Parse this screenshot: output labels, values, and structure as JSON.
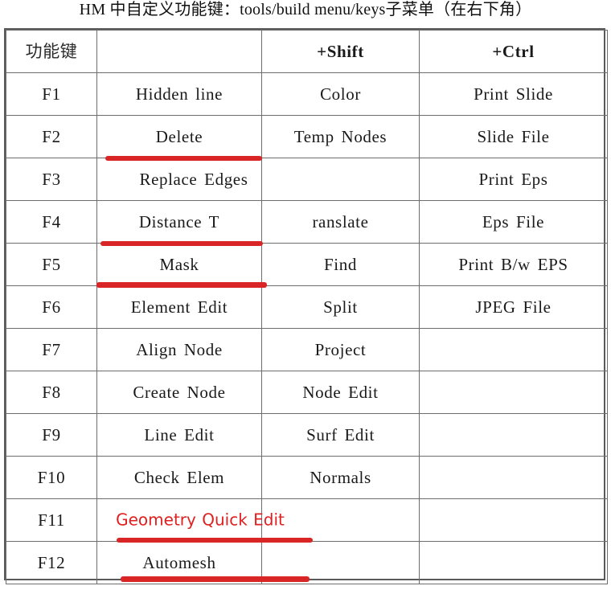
{
  "title": "HM 中自定义功能键：tools/build  menu/keys子菜单（在右下角）",
  "table": {
    "headers": {
      "key": "功能键",
      "plain": "",
      "shift": "+Shift",
      "ctrl": "+Ctrl"
    },
    "rows": [
      {
        "key": "F1",
        "plain": "Hidden  line",
        "shift": "Color",
        "ctrl": "Print  Slide"
      },
      {
        "key": "F2",
        "plain": "Delete",
        "shift": "Temp  Nodes",
        "ctrl": "Slide  File"
      },
      {
        "key": "F3",
        "plain": "Replace  Edges",
        "shift": "",
        "ctrl": "Print Eps"
      },
      {
        "key": "F4",
        "plain": "Distance  T",
        "shift": "ranslate",
        "ctrl": "Eps File"
      },
      {
        "key": "F5",
        "plain": "Mask",
        "shift": "Find",
        "ctrl": "Print  B/w  EPS"
      },
      {
        "key": "F6",
        "plain": "Element  Edit",
        "shift": "Split",
        "ctrl": "JPEG  File"
      },
      {
        "key": "F7",
        "plain": "Align  Node",
        "shift": "Project",
        "ctrl": ""
      },
      {
        "key": "F8",
        "plain": "Create  Node",
        "shift": "Node  Edit",
        "ctrl": ""
      },
      {
        "key": "F9",
        "plain": "Line  Edit",
        "shift": "Surf  Edit",
        "ctrl": ""
      },
      {
        "key": "F10",
        "plain": "Check  Elem",
        "shift": "Normals",
        "ctrl": ""
      },
      {
        "key": "F11",
        "plain": "Geometry Quick Edit",
        "shift": "",
        "ctrl": ""
      },
      {
        "key": "F12",
        "plain": "Automesh",
        "shift": "",
        "ctrl": ""
      }
    ]
  },
  "annotations": {
    "underline_color": "#d92525",
    "highlight_text_color": "#e02020",
    "underlined_rows": [
      "F2",
      "F4",
      "F5",
      "F11",
      "F12"
    ],
    "red_text_rows": [
      "F11"
    ]
  }
}
